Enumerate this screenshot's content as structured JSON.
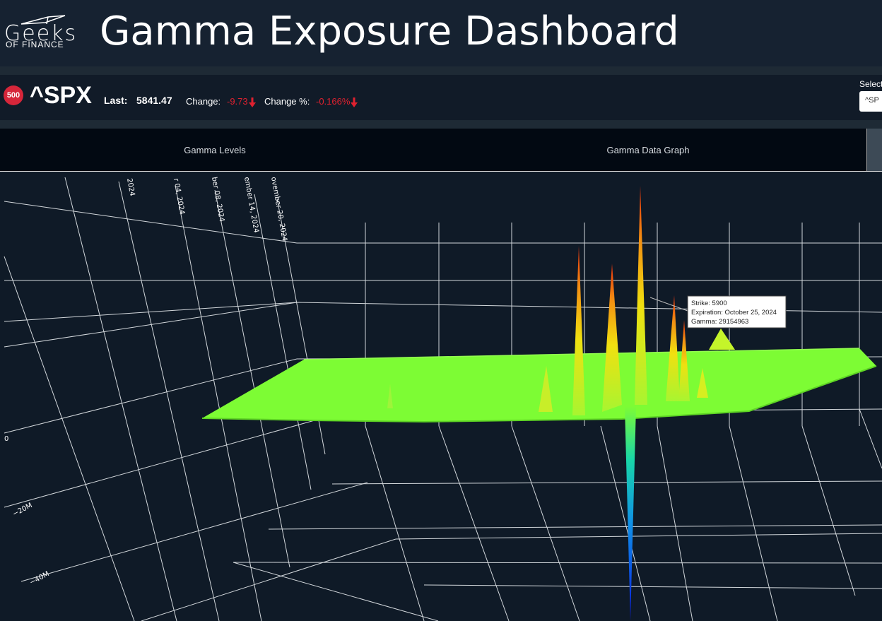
{
  "header": {
    "logo_text": "Geeks",
    "logo_sub": "OF FINANCE",
    "title": "Gamma Exposure Dashboard"
  },
  "ticker": {
    "badge": "500",
    "symbol": "^SPX",
    "last_label": "Last:",
    "last_value": "5841.47",
    "change_label": "Change:",
    "change_value": "-9.73",
    "change_pct_label": "Change %:",
    "change_pct_value": "-0.166%",
    "select_label": "Select",
    "select_value": "^SP"
  },
  "tabs": [
    {
      "label": "Gamma Levels"
    },
    {
      "label": "Gamma Data Graph"
    }
  ],
  "chart": {
    "y_axis_labels": [
      "0",
      "−20M",
      "−40M"
    ],
    "date_axis_labels": [
      "r 04, 2024",
      "ber 08, 2024",
      "ember 14, 2024",
      "ovember 20, 2024"
    ],
    "partial_axis_labels": [
      "2024"
    ],
    "tooltip": {
      "strike": "Strike: 5900",
      "expiration": "Expiration: October 25, 2024",
      "gamma": "Gamma: 29154963"
    },
    "colors": {
      "surface": "#7dfc34",
      "peak": "#e8300c",
      "trough": "#0818e0",
      "accent_red": "#e0212f"
    }
  }
}
